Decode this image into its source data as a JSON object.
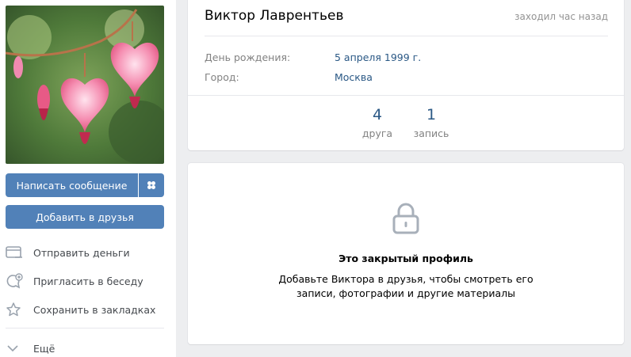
{
  "profile": {
    "name": "Виктор Лаврентьев",
    "last_seen": "заходил час назад",
    "info": [
      {
        "label": "День рождения:",
        "value": "5 апреля 1999 г."
      },
      {
        "label": "Город:",
        "value": "Москва"
      }
    ],
    "counters": [
      {
        "value": "4",
        "label": "друга"
      },
      {
        "value": "1",
        "label": "запись"
      }
    ]
  },
  "sidebar": {
    "write_message": "Написать сообщение",
    "add_friend": "Добавить в друзья",
    "actions": [
      {
        "label": "Отправить деньги",
        "icon": "money-card-icon"
      },
      {
        "label": "Пригласить в беседу",
        "icon": "chat-invite-icon"
      },
      {
        "label": "Сохранить в закладках",
        "icon": "star-icon"
      }
    ],
    "more": "Ещё"
  },
  "private": {
    "title": "Это закрытый профиль",
    "description": "Добавьте Виктора в друзья, чтобы смотреть его записи, фотографии и другие материалы",
    "icon": "lock-icon"
  },
  "colors": {
    "accent": "#5181b8",
    "link": "#2a5885",
    "background": "#edeef0"
  }
}
